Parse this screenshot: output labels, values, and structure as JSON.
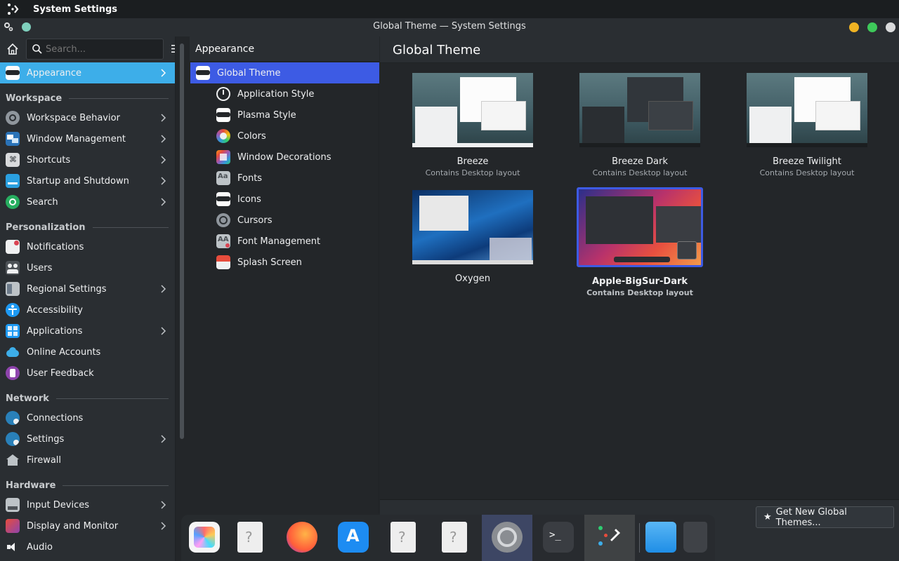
{
  "appbar": {
    "title": "System Settings"
  },
  "window": {
    "title": "Global Theme — System Settings"
  },
  "search": {
    "placeholder": "Search..."
  },
  "sidebar": {
    "active": {
      "label": "Appearance"
    },
    "sections": [
      {
        "header": "Workspace",
        "items": [
          {
            "label": "Workspace Behavior"
          },
          {
            "label": "Window Management"
          },
          {
            "label": "Shortcuts"
          },
          {
            "label": "Startup and Shutdown"
          },
          {
            "label": "Search"
          }
        ]
      },
      {
        "header": "Personalization",
        "items": [
          {
            "label": "Notifications"
          },
          {
            "label": "Users"
          },
          {
            "label": "Regional Settings"
          },
          {
            "label": "Accessibility"
          },
          {
            "label": "Applications"
          },
          {
            "label": "Online Accounts"
          },
          {
            "label": "User Feedback"
          }
        ]
      },
      {
        "header": "Network",
        "items": [
          {
            "label": "Connections"
          },
          {
            "label": "Settings"
          },
          {
            "label": "Firewall"
          }
        ]
      },
      {
        "header": "Hardware",
        "items": [
          {
            "label": "Input Devices"
          },
          {
            "label": "Display and Monitor"
          },
          {
            "label": "Audio"
          }
        ]
      }
    ]
  },
  "middle": {
    "title": "Appearance",
    "items": [
      {
        "label": "Global Theme"
      },
      {
        "label": "Application Style"
      },
      {
        "label": "Plasma Style"
      },
      {
        "label": "Colors"
      },
      {
        "label": "Window Decorations"
      },
      {
        "label": "Fonts"
      },
      {
        "label": "Icons"
      },
      {
        "label": "Cursors"
      },
      {
        "label": "Font Management"
      },
      {
        "label": "Splash Screen"
      }
    ]
  },
  "main": {
    "title": "Global Theme",
    "themes": [
      {
        "name": "Breeze",
        "sub": "Contains Desktop layout"
      },
      {
        "name": "Breeze Dark",
        "sub": "Contains Desktop layout"
      },
      {
        "name": "Breeze Twilight",
        "sub": "Contains Desktop layout"
      },
      {
        "name": "Oxygen",
        "sub": ""
      },
      {
        "name": "Apple-BigSur-Dark",
        "sub": "Contains Desktop layout"
      }
    ],
    "get_new_label": "Get New Global Themes..."
  },
  "colors": {
    "accent": "#3daee9",
    "selection": "#3d5be4"
  }
}
